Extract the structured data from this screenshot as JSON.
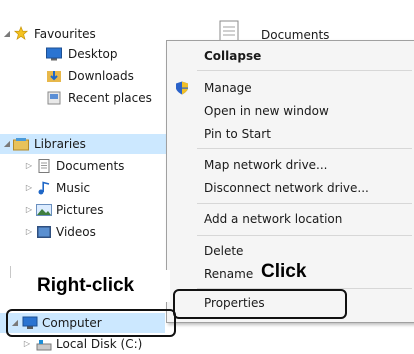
{
  "nav": {
    "favourites": "Favourites",
    "desktop": "Desktop",
    "downloads": "Downloads",
    "recent_places": "Recent places",
    "libraries": "Libraries",
    "documents": "Documents",
    "music": "Music",
    "pictures": "Pictures",
    "videos": "Videos",
    "computer": "Computer",
    "local_disk": "Local Disk (C:)"
  },
  "content": {
    "documents": "Documents"
  },
  "menu": {
    "collapse": "Collapse",
    "manage": "Manage",
    "open_new_window": "Open in new window",
    "pin_to_start": "Pin to Start",
    "map_network_drive": "Map network drive...",
    "disconnect_network_drive": "Disconnect network drive...",
    "add_network_location": "Add a network location",
    "delete": "Delete",
    "rename": "Rename",
    "properties": "Properties"
  },
  "callouts": {
    "right_click": "Right-click",
    "click": "Click"
  },
  "icons": {
    "favourites": "star-icon",
    "desktop": "desktop-icon",
    "downloads": "downloads-icon",
    "recent_places": "recent-places-icon",
    "libraries": "library-icon",
    "documents": "document-icon",
    "music": "music-icon",
    "pictures": "pictures-icon",
    "videos": "videos-icon",
    "computer": "computer-icon",
    "local_disk": "disk-icon",
    "manage": "shield-icon"
  },
  "colors": {
    "selection": "#cce8ff",
    "menu_bg": "#f5f5f5",
    "menu_border": "#a0a0a0"
  }
}
